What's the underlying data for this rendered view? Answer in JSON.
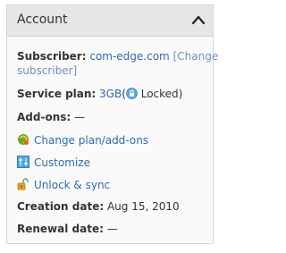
{
  "panel": {
    "title": "Account",
    "collapse_icon": "chevron-up-icon"
  },
  "subscriber": {
    "label": "Subscriber:",
    "domain": "com-edge.com",
    "change_link_part1": "[Change",
    "change_link_part2": "subscriber]"
  },
  "service_plan": {
    "label": "Service plan:",
    "plan": "3GB",
    "open_paren": "(",
    "locked_label": "Locked)",
    "lock_icon": "lock-icon"
  },
  "addons": {
    "label": "Add-ons:",
    "value": "—"
  },
  "actions": [
    {
      "label": "Change plan/add-ons",
      "icon": "change-plan-icon"
    },
    {
      "label": "Customize",
      "icon": "customize-icon"
    },
    {
      "label": "Unlock & sync",
      "icon": "unlock-icon"
    }
  ],
  "creation": {
    "label": "Creation date:",
    "value": "Aug 15, 2010"
  },
  "renewal": {
    "label": "Renewal date:",
    "value": "—"
  }
}
